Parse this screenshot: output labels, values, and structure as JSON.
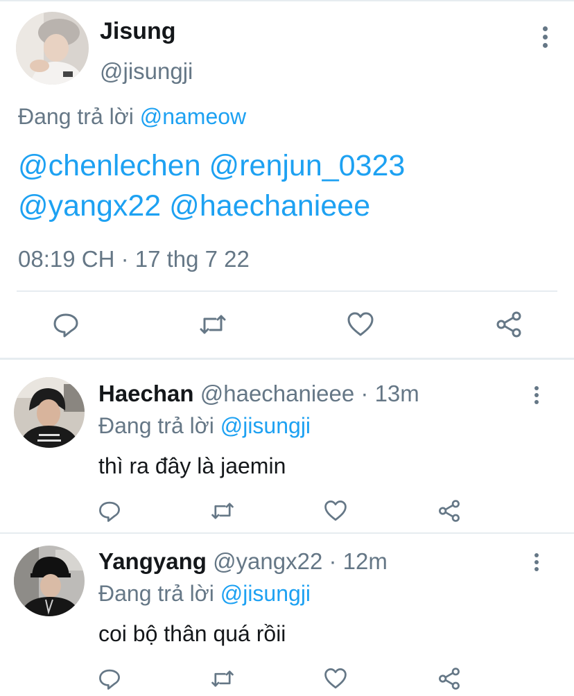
{
  "main_tweet": {
    "name": "Jisung",
    "handle": "@jisungji",
    "reply_prefix": "Đang trả lời",
    "reply_to": "@nameow",
    "text_line1": "@chenlechen @renjun_0323",
    "text_line2": "@yangx22 @haechanieee",
    "timestamp": "08:19 CH · 17 thg 7 22"
  },
  "replies": [
    {
      "name": "Haechan",
      "handle": "@haechanieee",
      "time": "· 13m",
      "reply_prefix": "Đang trả lời",
      "reply_to": "@jisungji",
      "text": "thì ra đây là jaemin"
    },
    {
      "name": "Yangyang",
      "handle": "@yangx22",
      "time": "· 12m",
      "reply_prefix": "Đang trả lời",
      "reply_to": "@jisungji",
      "text": "coi bộ thân quá rồii"
    }
  ],
  "icons": {
    "reply": "speech-bubble",
    "retweet": "retweet-arrows",
    "like": "heart-outline",
    "share": "share-nodes",
    "more": "vertical-dots"
  },
  "colors": {
    "link": "#1da1f2",
    "secondary_text": "#657786",
    "primary_text": "#14171a",
    "divider": "#e6ecf0"
  }
}
